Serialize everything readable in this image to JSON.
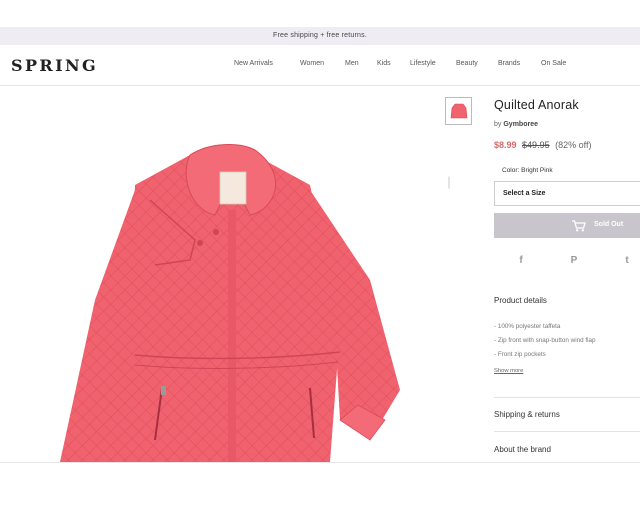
{
  "promo": {
    "text": "Free shipping + free returns."
  },
  "header": {
    "logo": "SPRING",
    "nav": [
      "New Arrivals",
      "Women",
      "Men",
      "Kids",
      "Lifestyle",
      "Beauty",
      "Brands",
      "On Sale"
    ]
  },
  "product": {
    "title": "Quilted Anorak",
    "brand_prefix": "by",
    "brand": "Gymboree",
    "sale_price": "$8.99",
    "original_price": "$49.95",
    "discount": "(82% off)",
    "color_label": "Color: Bright Pink",
    "size_placeholder": "Select a Size",
    "sold_out_label": "Sold Out",
    "jacket_color": "#f0626e"
  },
  "social": [
    "f",
    "P",
    "t"
  ],
  "details": {
    "heading": "Product details",
    "bullets": [
      "- 100% polyester taffeta",
      "- Zip front with snap-button wind flap",
      "- Front zip pockets"
    ],
    "show_more": "Show more"
  },
  "sections": {
    "shipping": "Shipping & returns",
    "about": "About the brand"
  },
  "icons": {
    "cart": "cart-icon",
    "facebook": "facebook-icon",
    "pinterest": "pinterest-icon",
    "twitter": "twitter-icon"
  }
}
